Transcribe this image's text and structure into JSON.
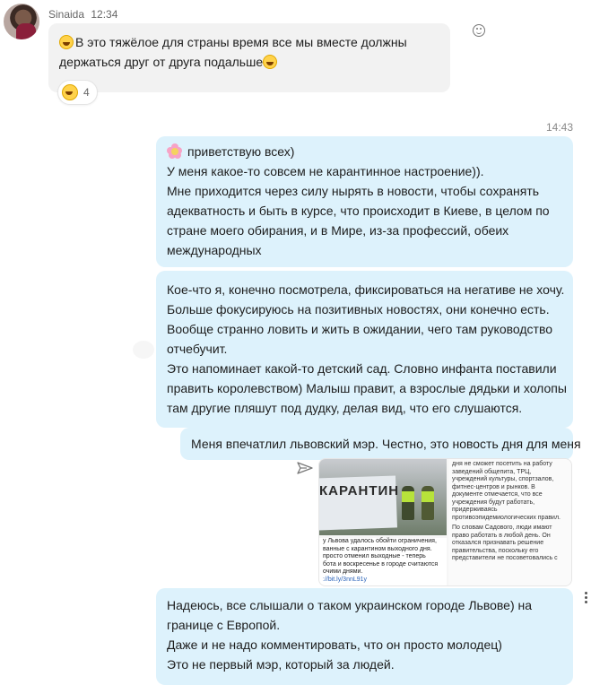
{
  "incoming": {
    "sender": "Sinaida",
    "time": "12:34",
    "text_line1": "В это тяжёлое для страны время все мы вместе должны",
    "text_line2": "держаться друг от друга подальше",
    "reaction_count": "4"
  },
  "outgoing_time": "14:43",
  "messages": {
    "m1": [
      "приветствую всех)",
      "У меня какое-то совсем не карантинное настроение)).",
      "Мне приходится через силу нырять в новости, чтобы сохранять",
      "адекватность и быть в курсе, что происходит в Киеве, в целом по",
      "стране моего обирания, и в Мире, из-за профессий, обеих",
      "международных"
    ],
    "m2": [
      "Кое-что я, конечно посмотрела, фиксироваться на негативе не хочу.",
      "Больше фокусируюсь на позитивных новостях, они конечно есть.",
      "Вообще странно ловить и жить в ожидании, чего там руководство",
      "отчебучит.",
      "Это напоминает какой-то детский сад. Словно инфанта поставили",
      "править королевством) Малыш правит, а взрослые дядьки и холопы",
      "там другие пляшут под дудку, делая вид, что его слушаются."
    ],
    "m3": "Меня впечатлил львовский мэр. Честно, это новость дня для меня",
    "m5": [
      "Надеюсь, все слышали о таком украинском городе Львове) на",
      "границе с Европой.",
      "Даже и не надо комментировать, что он просто молодец)",
      "Это не первый мэр, который за людей."
    ]
  },
  "preview": {
    "photo_sign": "КАРАНТИН",
    "caption": [
      "у Львова удалось обойти ограничения,",
      "ванные с карантином выходного дня.",
      "просто отменил выходные - теперь",
      "бота и воскресенье в городе считаются",
      "очими днями."
    ],
    "caption_link": "://bit.ly/3nnL91y",
    "right_p1": [
      "дня не сможет посетить на работу",
      "заведений общепита, ТРЦ,",
      "учреждений культуры, спортзалов,",
      "фитнес-центров и рынков. В",
      "документе отмечается, что все",
      "учреждения будут работать,",
      "придерживаясь",
      "противоэпидемиологических правил."
    ],
    "right_p2": [
      "По словам Садового, люди имают",
      "право работать в любой день. Он",
      "отказался признавать решение",
      "правительства, поскольку его",
      "представители не посоветовались с"
    ]
  },
  "icons": {
    "avatar": "user-avatar",
    "add_reaction": "smiley-outline-icon",
    "forward": "forward-arrow-icon",
    "more": "vertical-dots-icon"
  },
  "colors": {
    "outgoing_bubble": "#ddf2fc",
    "incoming_bubble": "#f2f2f2"
  }
}
